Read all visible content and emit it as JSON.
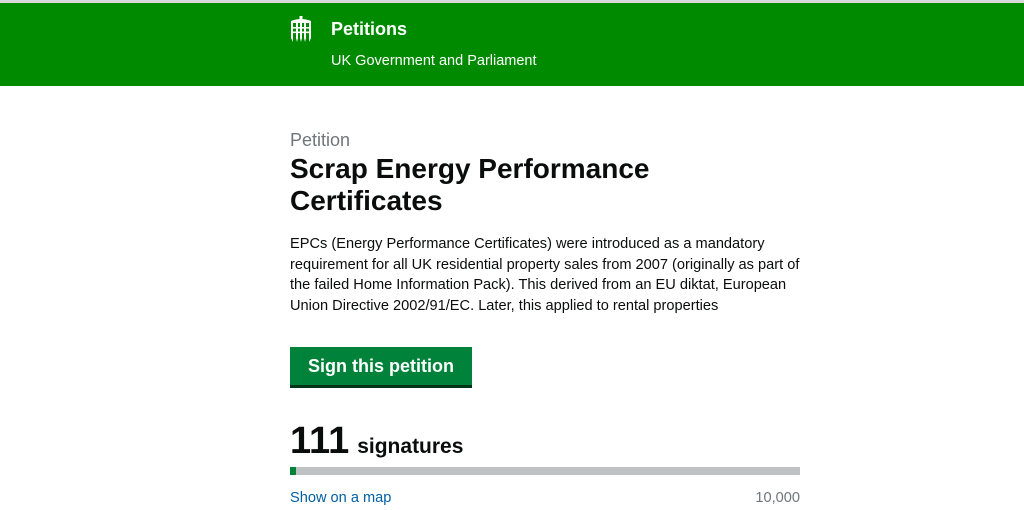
{
  "header": {
    "crest_icon": "portcullis-icon",
    "title": "Petitions",
    "subtitle": "UK Government and Parliament",
    "background_color": "#008a00"
  },
  "petition": {
    "kicker": "Petition",
    "title": "Scrap Energy Performance Certificates",
    "description": "EPCs (Energy Performance Certificates) were introduced as a mandatory requirement for all UK residential property sales from 2007 (originally as part of the failed Home Information Pack). This derived from an EU diktat, European Union Directive 2002/91/EC. Later, this applied to rental properties",
    "sign_button_label": "Sign this petition",
    "button_color": "#00823b"
  },
  "signatures": {
    "count": "111",
    "label": "signatures",
    "target": "10,000",
    "progress_fraction": 0.0111,
    "map_link": "Show on a map"
  }
}
